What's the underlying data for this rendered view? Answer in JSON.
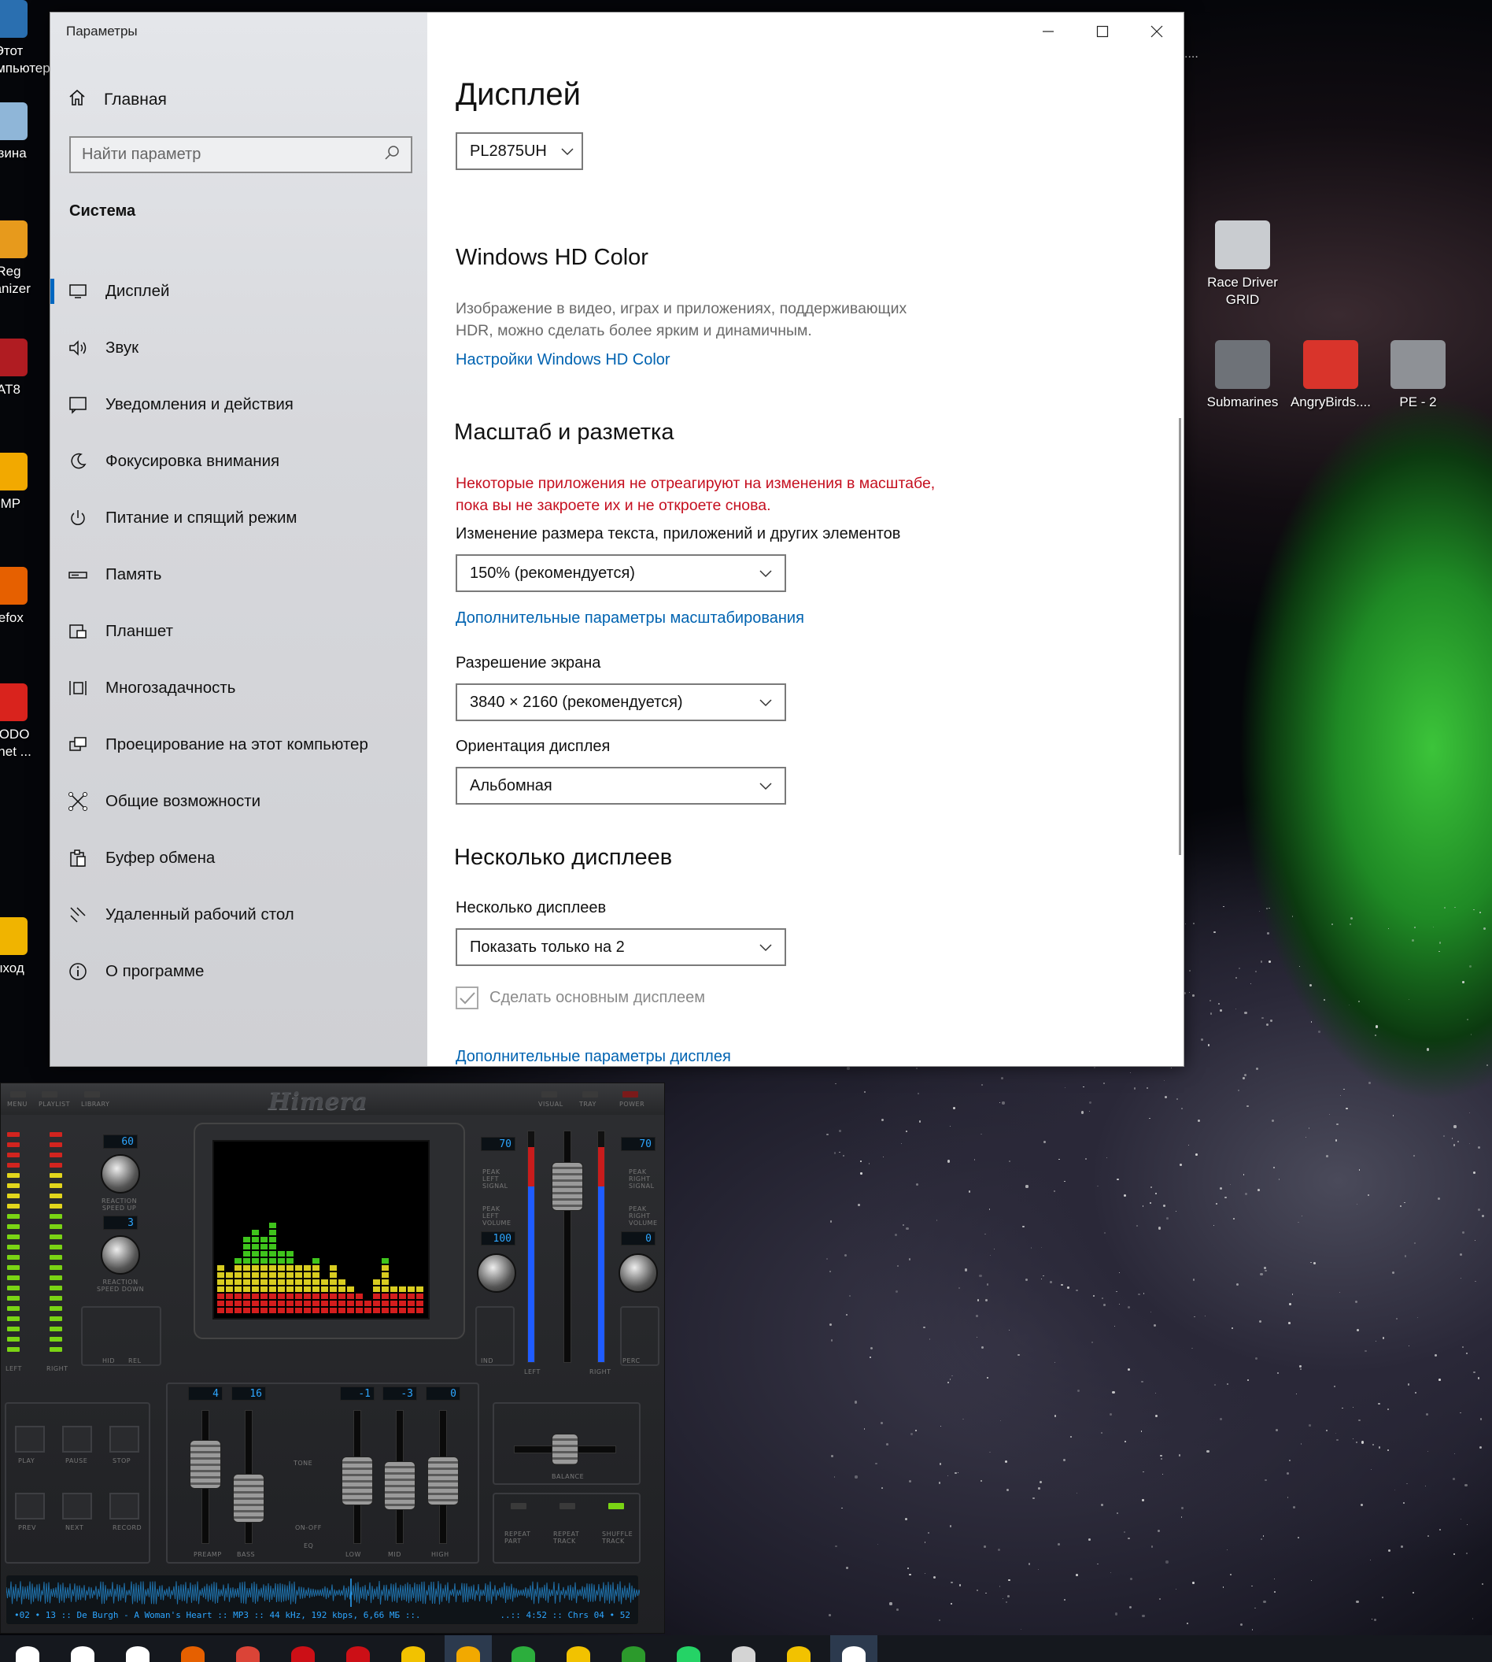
{
  "desktop": {
    "left_icons": [
      {
        "label": "Этот\nкомпьютер",
        "icon": "computer-icon",
        "color": "#2a6fb0"
      },
      {
        "label": "рзина",
        "icon": "recycle-bin-icon",
        "color": "#8fb6d8"
      },
      {
        "label": "Reg\nganizer",
        "icon": "reg-organizer-icon",
        "color": "#e79a1c"
      },
      {
        "label": "AT8",
        "icon": "mad-catz-icon",
        "color": "#b01c22"
      },
      {
        "label": "IMP",
        "icon": "aimp-icon",
        "color": "#f2a900"
      },
      {
        "label": "refox",
        "icon": "firefox-icon",
        "color": "#e66000"
      },
      {
        "label": "MODO\nernet ...",
        "icon": "comodo-icon",
        "color": "#d9231d"
      },
      {
        "label": "ыход",
        "icon": "key-icon",
        "color": "#f0b400"
      }
    ],
    "right_icons": [
      {
        "label": "Race Driver\nGRID",
        "icon": "race-driver-grid-icon"
      },
      {
        "label": "Submarines",
        "icon": "submarines-icon"
      },
      {
        "label": "AngryBirds....",
        "icon": "angry-birds-icon"
      },
      {
        "label": "PE - 2",
        "icon": "pe2-plane-icon"
      }
    ],
    "tray_text": "...."
  },
  "settings": {
    "window_title": "Параметры",
    "home_label": "Главная",
    "search_placeholder": "Найти параметр",
    "section": "Система",
    "nav": [
      {
        "label": "Дисплей",
        "icon": "display-icon",
        "active": true
      },
      {
        "label": "Звук",
        "icon": "sound-icon"
      },
      {
        "label": "Уведомления и действия",
        "icon": "notifications-icon"
      },
      {
        "label": "Фокусировка внимания",
        "icon": "focus-assist-icon"
      },
      {
        "label": "Питание и спящий режим",
        "icon": "power-icon"
      },
      {
        "label": "Память",
        "icon": "storage-icon"
      },
      {
        "label": "Планшет",
        "icon": "tablet-icon"
      },
      {
        "label": "Многозадачность",
        "icon": "multitasking-icon"
      },
      {
        "label": "Проецирование на этот компьютер",
        "icon": "projecting-icon"
      },
      {
        "label": "Общие возможности",
        "icon": "shared-experiences-icon"
      },
      {
        "label": "Буфер обмена",
        "icon": "clipboard-icon"
      },
      {
        "label": "Удаленный рабочий стол",
        "icon": "remote-desktop-icon"
      },
      {
        "label": "О программе",
        "icon": "about-icon"
      }
    ],
    "page": {
      "title": "Дисплей",
      "monitor": "PL2875UH",
      "hdr": {
        "heading": "Windows HD Color",
        "description_line1": "Изображение в видео, играх и приложениях, поддерживающих",
        "description_line2": "HDR, можно сделать более ярким и динамичным.",
        "link": "Настройки Windows HD Color"
      },
      "scale": {
        "heading": "Масштаб и разметка",
        "warning_line1": "Некоторые приложения не отреагируют на изменения в масштабе,",
        "warning_line2": "пока вы не закроете их и не откроете снова.",
        "size_label": "Изменение размера текста, приложений и других элементов",
        "size_value": "150% (рекомендуется)",
        "advanced_link": "Дополнительные параметры масштабирования",
        "resolution_label": "Разрешение экрана",
        "resolution_value": "3840 × 2160 (рекомендуется)",
        "orientation_label": "Ориентация дисплея",
        "orientation_value": "Альбомная"
      },
      "multi": {
        "heading": "Несколько дисплеев",
        "label": "Несколько дисплеев",
        "value": "Показать только на 2",
        "checkbox_label": "Сделать основным дисплеем",
        "checkbox_checked": true,
        "advanced_link": "Дополнительные параметры дисплея"
      }
    },
    "colors": {
      "accent": "#0067c0",
      "link": "#0063b1",
      "warning": "#c50f1f"
    }
  },
  "player": {
    "brand": "Himera",
    "top_buttons": [
      "MENU",
      "PLAYLIST",
      "LIBRARY",
      "VISUAL",
      "TRAY",
      "POWER"
    ],
    "readouts": {
      "reaction_up": "60",
      "reaction_down": "3",
      "left_signal": "70",
      "right_signal": "70",
      "left_volume": "100",
      "right_volume": "0",
      "preamp": "4",
      "bass": "16",
      "low": "-1",
      "mid": "-3",
      "high": "0"
    },
    "labels": {
      "reaction_up": "REACTION\nSPEED UP",
      "reaction_down": "REACTION\nSPEED DOWN",
      "left": "LEFT",
      "right": "RIGHT",
      "peak_left_signal": "PEAK\nLEFT\nSIGNAL",
      "peak_left_volume": "PEAK\nLEFT\nVOLUME",
      "peak_right_signal": "PEAK\nRIGHT\nSIGNAL",
      "peak_right_volume": "PEAK\nRIGHT\nVOLUME",
      "hid": "HID",
      "rel": "REL",
      "ind": "IND",
      "perc": "PERC",
      "on": "ON",
      "off": "OFF",
      "tone": "TONE",
      "on_off": "ON-OFF",
      "eq": "EQ",
      "balance": "BALANCE",
      "preamp": "PREAMP",
      "bass": "BASS",
      "low": "LOW",
      "mid": "MID",
      "high": "HIGH"
    },
    "transport": [
      "PLAY",
      "PAUSE",
      "STOP",
      "PREV",
      "NEXT",
      "RECORD"
    ],
    "repeat": [
      "REPEAT\nPART",
      "REPEAT\nTRACK",
      "SHUFFLE\nTRACK"
    ],
    "status_left": "•02 • 13 :: De Burgh - A Woman's Heart :: MP3 :: 44 kHz, 192 kbps, 6,66 МБ ::.",
    "status_right": "..:: 4:52 :: Chrs 04 • 52",
    "spectrum": [
      7,
      6,
      8,
      11,
      12,
      11,
      13,
      9,
      9,
      7,
      7,
      8,
      5,
      7,
      5,
      4,
      3,
      2,
      5,
      8,
      4,
      4,
      4,
      4
    ]
  },
  "taskbar": {
    "apps": [
      {
        "icon": "start-icon",
        "color": "#ffffff"
      },
      {
        "icon": "search-icon",
        "color": "#ffffff"
      },
      {
        "icon": "task-view-icon",
        "color": "#ffffff"
      },
      {
        "icon": "firefox-icon",
        "color": "#e66000"
      },
      {
        "icon": "chrome-icon",
        "color": "#db4437"
      },
      {
        "icon": "opera-icon",
        "color": "#cc0f16"
      },
      {
        "icon": "opera-gx-icon",
        "color": "#cc0f16"
      },
      {
        "icon": "notes-icon",
        "color": "#f2c200"
      },
      {
        "icon": "aimp-icon",
        "color": "#f2a900"
      },
      {
        "icon": "utorrent-icon",
        "color": "#2cae3d"
      },
      {
        "icon": "star-icon",
        "color": "#f2c200"
      },
      {
        "icon": "tree-icon",
        "color": "#2c9a2c"
      },
      {
        "icon": "whatsapp-icon",
        "color": "#25d366"
      },
      {
        "icon": "game-icon",
        "color": "#d4d4d4"
      },
      {
        "icon": "folder-icon",
        "color": "#f2c200"
      },
      {
        "icon": "settings-icon",
        "color": "#ffffff"
      }
    ]
  }
}
